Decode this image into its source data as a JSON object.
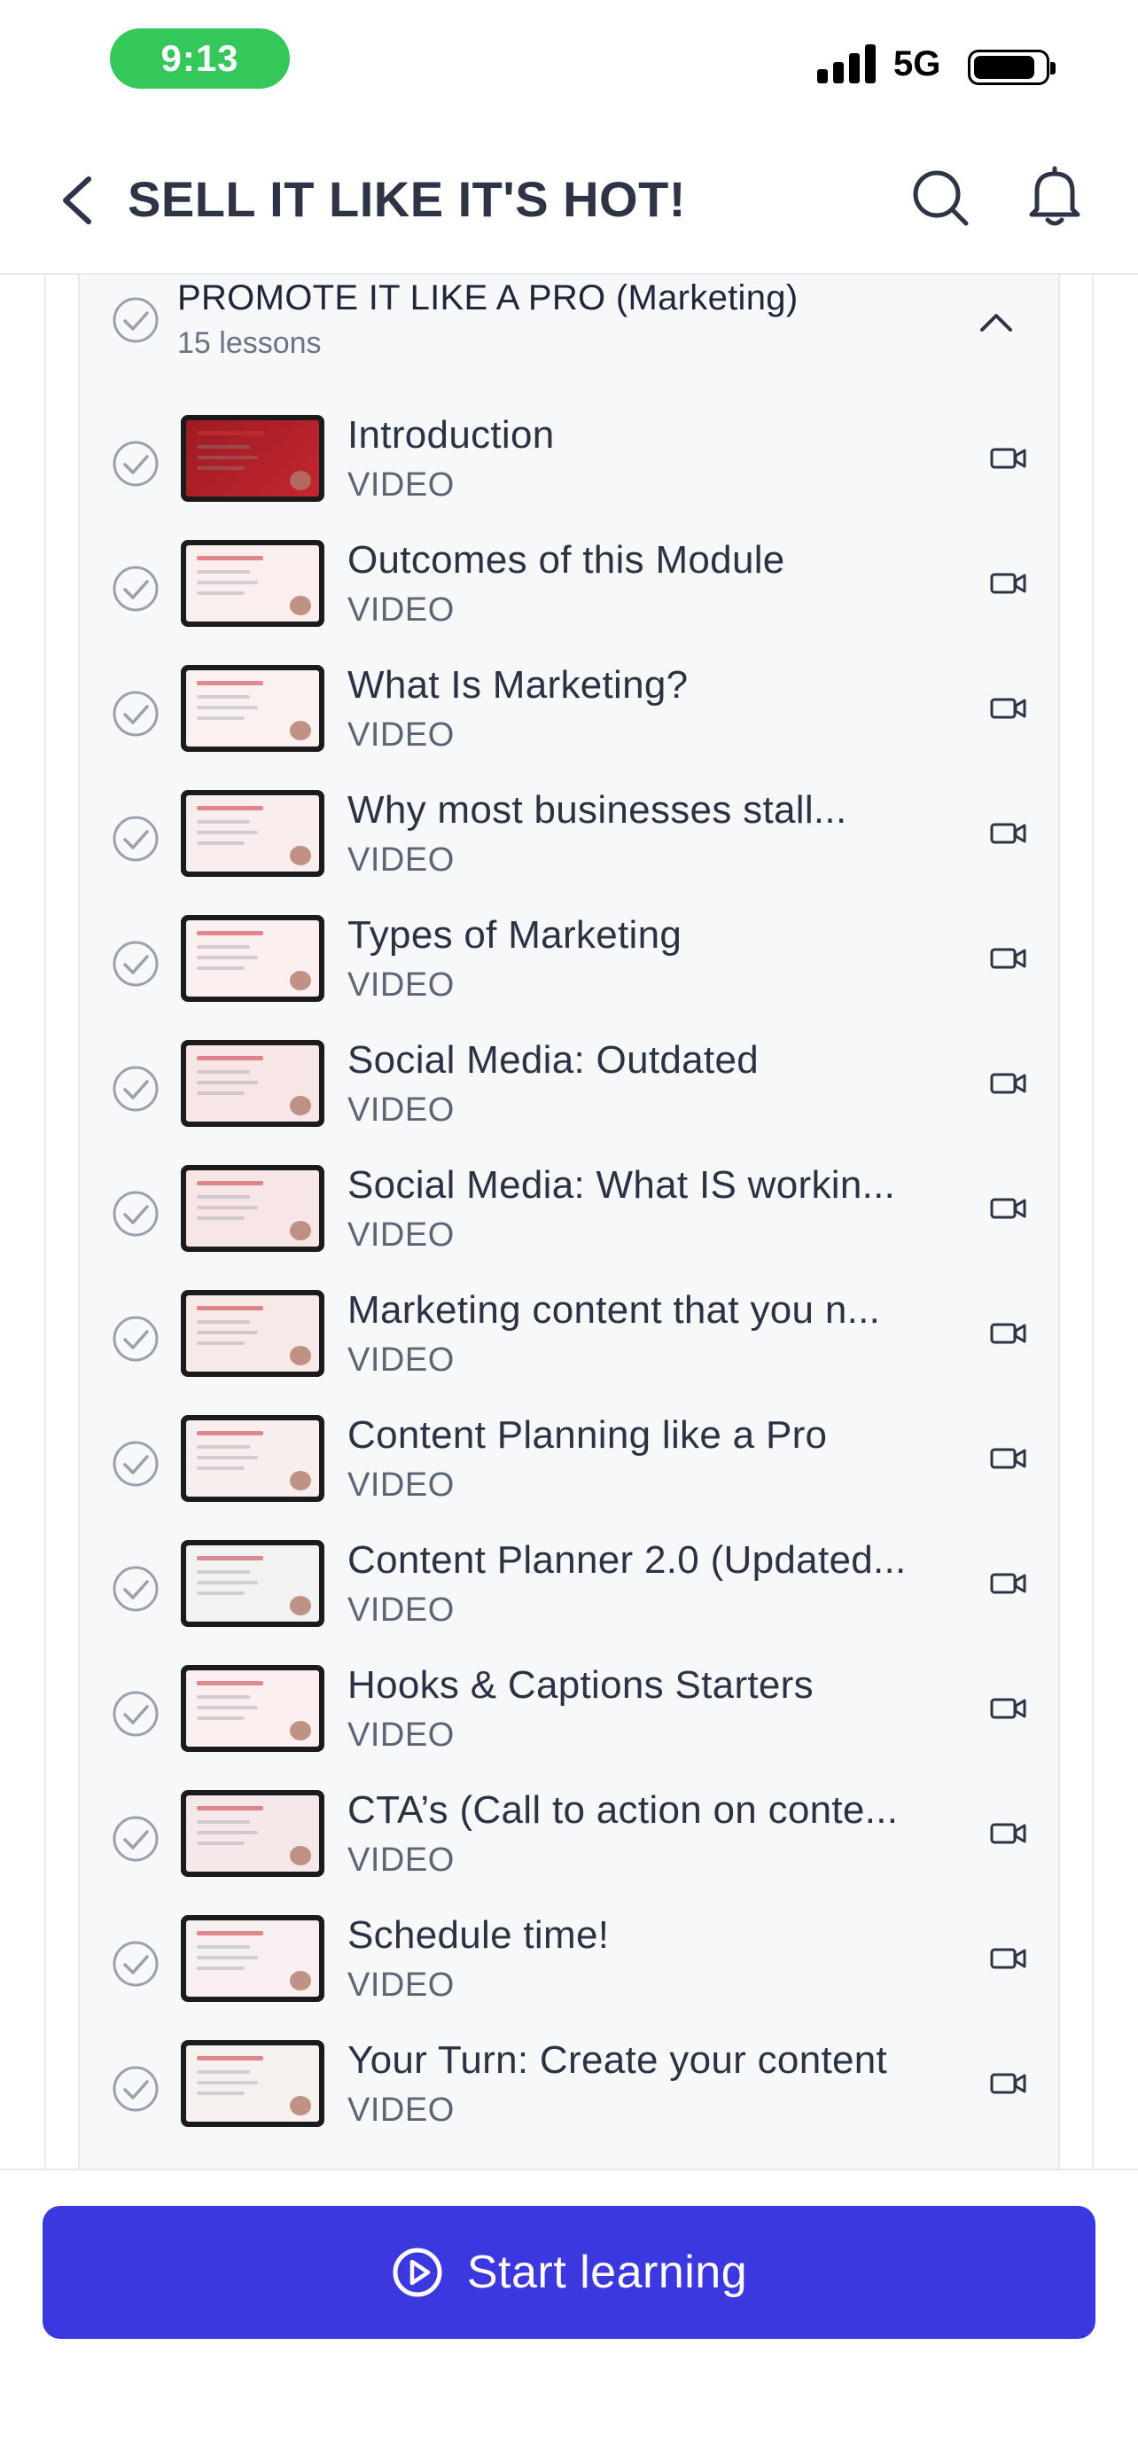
{
  "status_bar": {
    "time": "9:13",
    "network": "5G",
    "time_pill_color": "#34c759"
  },
  "header": {
    "title": "SELL IT LIKE IT'S HOT!",
    "icons": [
      "back-chevron-icon",
      "search-icon",
      "bell-icon"
    ]
  },
  "module": {
    "title": "PROMOTE IT LIKE A PRO (Marketing)",
    "lesson_count": "15 lessons",
    "lessons": [
      {
        "title": "Introduction",
        "type": "VIDEO"
      },
      {
        "title": "Outcomes of this Module",
        "type": "VIDEO"
      },
      {
        "title": "What Is Marketing?",
        "type": "VIDEO"
      },
      {
        "title": "Why most businesses stall...",
        "type": "VIDEO"
      },
      {
        "title": "Types of Marketing",
        "type": "VIDEO"
      },
      {
        "title": "Social Media: Outdated",
        "type": "VIDEO"
      },
      {
        "title": "Social Media: What IS workin...",
        "type": "VIDEO"
      },
      {
        "title": "Marketing content that you n...",
        "type": "VIDEO"
      },
      {
        "title": "Content Planning like a Pro",
        "type": "VIDEO"
      },
      {
        "title": "Content Planner 2.0 (Updated...",
        "type": "VIDEO"
      },
      {
        "title": "Hooks & Captions Starters",
        "type": "VIDEO"
      },
      {
        "title": "CTA’s (Call to action on conte...",
        "type": "VIDEO"
      },
      {
        "title": "Schedule time!",
        "type": "VIDEO"
      },
      {
        "title": "Your Turn: Create your content",
        "type": "VIDEO"
      }
    ]
  },
  "footer": {
    "start_label": "Start learning",
    "button_color": "#3b38e0"
  },
  "colors": {
    "accent": "#3b38e0",
    "text_primary": "#2b3244",
    "text_secondary": "#5d6476",
    "module_bg": "#f7f8fa"
  }
}
